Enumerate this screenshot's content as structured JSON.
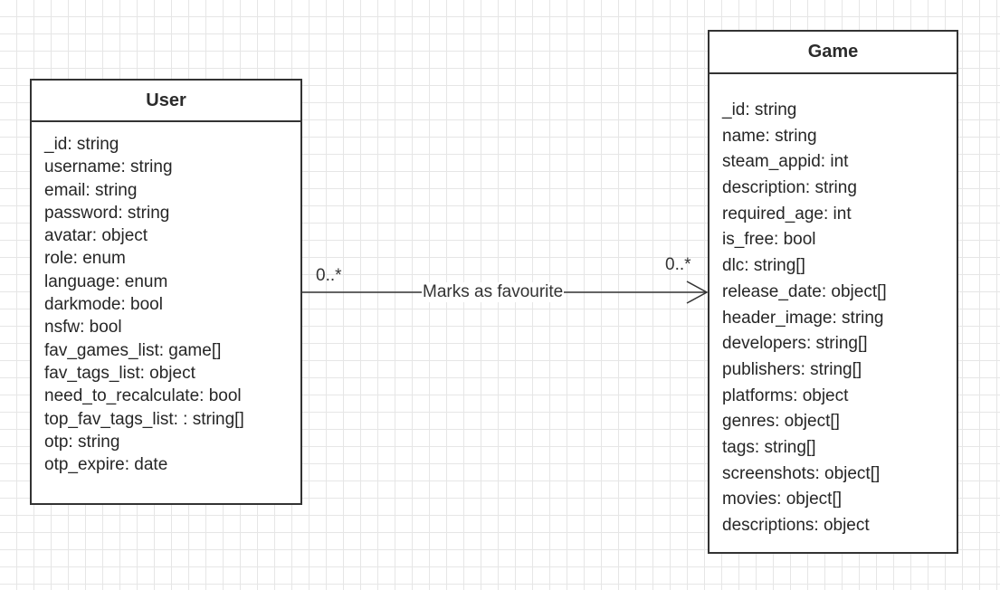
{
  "classes": {
    "user": {
      "name": "User",
      "attributes": [
        "_id: string",
        "username: string",
        "email: string",
        "password: string",
        "avatar: object",
        "role: enum",
        "language: enum",
        "darkmode: bool",
        "nsfw: bool",
        "fav_games_list: game[]",
        "fav_tags_list: object",
        "need_to_recalculate: bool",
        "top_fav_tags_list: : string[]",
        "otp: string",
        "otp_expire: date"
      ]
    },
    "game": {
      "name": "Game",
      "attributes": [
        "_id: string",
        "name: string",
        "steam_appid: int",
        "description: string",
        "required_age: int",
        "is_free: bool",
        "dlc: string[]",
        "release_date: object[]",
        "header_image: string",
        "developers: string[]",
        "publishers: string[]",
        "platforms: object",
        "genres: object[]",
        "tags: string[]",
        "screenshots: object[]",
        "movies: object[]",
        "descriptions: object"
      ]
    }
  },
  "association": {
    "label": "Marks as favourite",
    "source_multiplicity": "0..*",
    "target_multiplicity": "0..*"
  }
}
